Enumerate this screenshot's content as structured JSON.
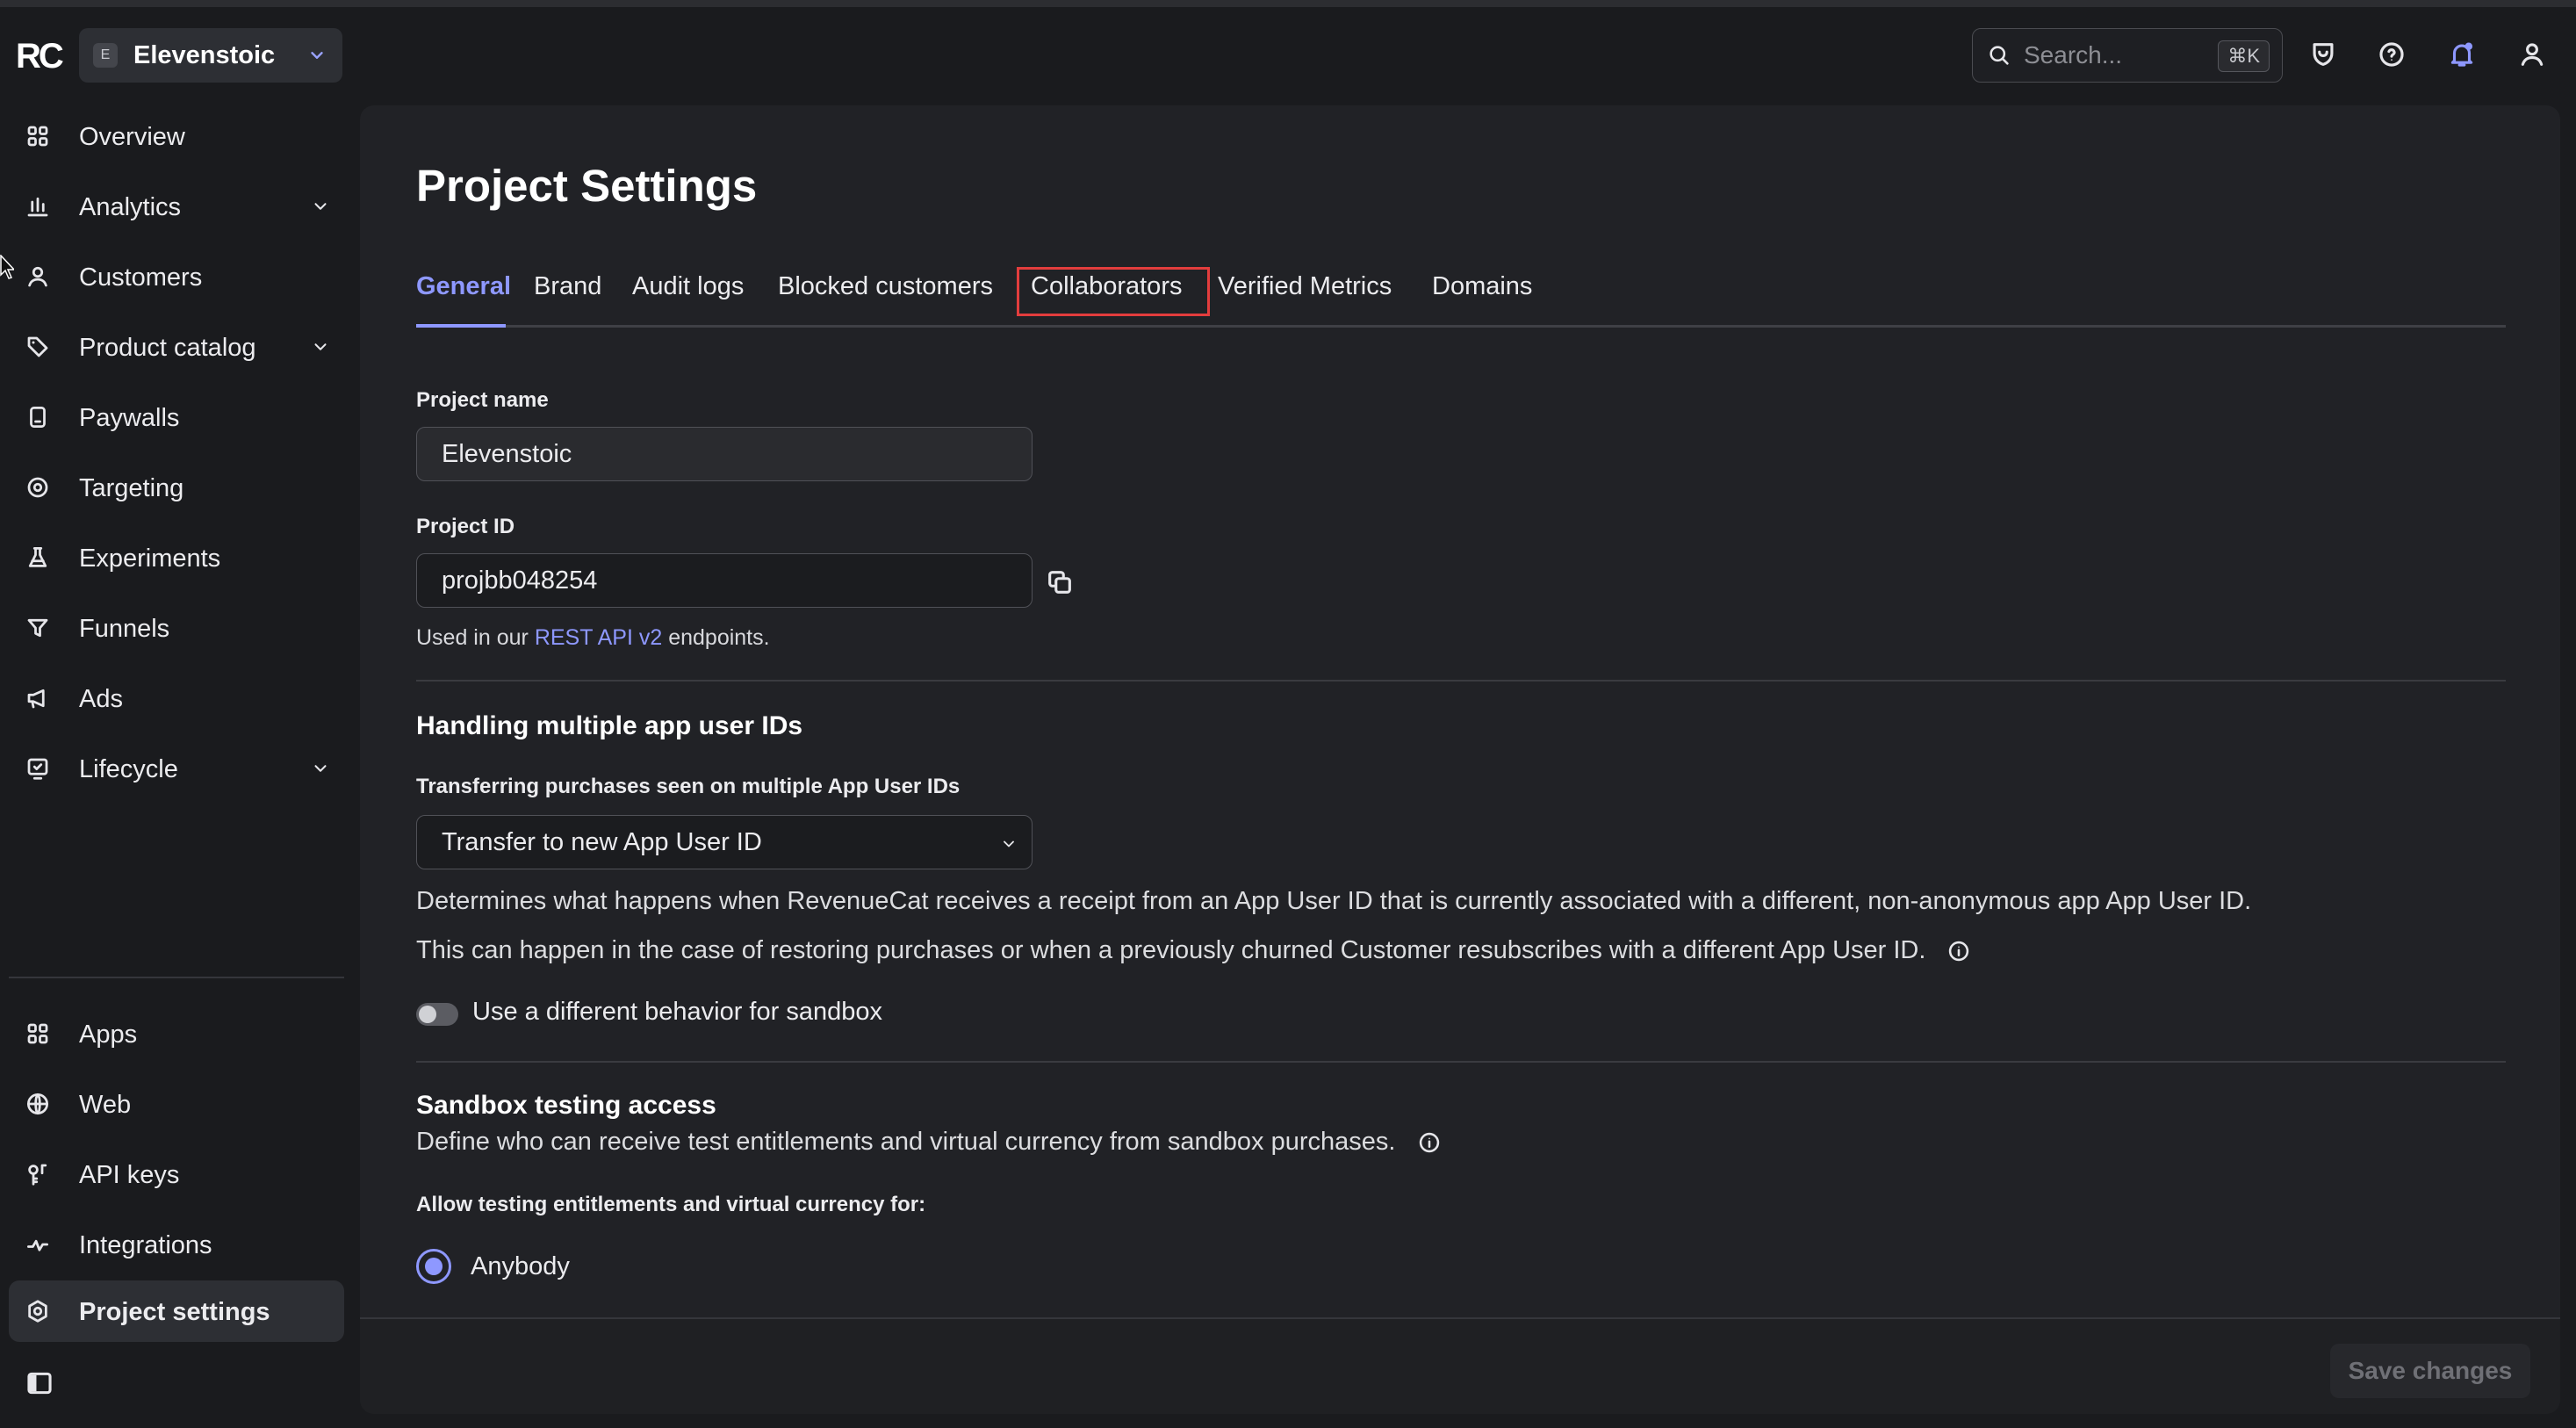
{
  "topbar": {
    "logo": "RC",
    "project_badge": "E",
    "project_name": "Elevenstoic",
    "search_placeholder": "Search...",
    "search_shortcut": "⌘K",
    "icons": [
      "shield-icon",
      "help-icon",
      "notifications-icon",
      "account-icon"
    ]
  },
  "sidebar": {
    "items": [
      {
        "label": "Overview",
        "icon": "grid-icon"
      },
      {
        "label": "Analytics",
        "icon": "chart-icon",
        "expandable": true
      },
      {
        "label": "Customers",
        "icon": "person-icon"
      },
      {
        "label": "Product catalog",
        "icon": "tag-icon",
        "expandable": true
      },
      {
        "label": "Paywalls",
        "icon": "phone-icon"
      },
      {
        "label": "Targeting",
        "icon": "target-icon"
      },
      {
        "label": "Experiments",
        "icon": "flask-icon"
      },
      {
        "label": "Funnels",
        "icon": "funnel-icon"
      },
      {
        "label": "Ads",
        "icon": "megaphone-icon"
      },
      {
        "label": "Lifecycle",
        "icon": "lifecycle-icon",
        "expandable": true
      }
    ],
    "bottom_items": [
      {
        "label": "Apps",
        "icon": "grid-icon"
      },
      {
        "label": "Web",
        "icon": "globe-icon"
      },
      {
        "label": "API keys",
        "icon": "key-icon"
      },
      {
        "label": "Integrations",
        "icon": "integrations-icon"
      },
      {
        "label": "Project settings",
        "icon": "settings-icon",
        "active": true
      }
    ]
  },
  "main": {
    "title": "Project Settings",
    "tabs": [
      {
        "label": "General",
        "active": true
      },
      {
        "label": "Brand"
      },
      {
        "label": "Audit logs"
      },
      {
        "label": "Blocked customers"
      },
      {
        "label": "Collaborators",
        "highlighted": true
      },
      {
        "label": "Verified Metrics"
      },
      {
        "label": "Domains"
      }
    ],
    "project_name_label": "Project name",
    "project_name_value": "Elevenstoic",
    "project_id_label": "Project ID",
    "project_id_value": "projbb048254",
    "project_id_help_prefix": "Used in our",
    "project_id_help_link": "REST API v2",
    "project_id_help_suffix": "endpoints.",
    "multi_ids_title": "Handling multiple app user IDs",
    "transfer_label": "Transferring purchases seen on multiple App User IDs",
    "transfer_value": "Transfer to new App User ID",
    "transfer_desc_1": "Determines what happens when RevenueCat receives a receipt from an App User ID that is currently associated with a different, non-anonymous app App User ID.",
    "transfer_desc_2": "This can happen in the case of restoring purchases or when a previously churned Customer resubscribes with a different App User ID.",
    "sandbox_toggle_label": "Use a different behavior for sandbox",
    "sandbox_toggle_on": false,
    "sandbox_title": "Sandbox testing access",
    "sandbox_desc": "Define who can receive test entitlements and virtual currency from sandbox purchases.",
    "allow_label": "Allow testing entitlements and virtual currency for:",
    "radio_option": "Anybody",
    "save_button": "Save changes"
  },
  "colors": {
    "accent": "#8e98ff",
    "highlight_border": "#e33d3d",
    "background": "#1a1b1e",
    "panel": "#212226"
  }
}
